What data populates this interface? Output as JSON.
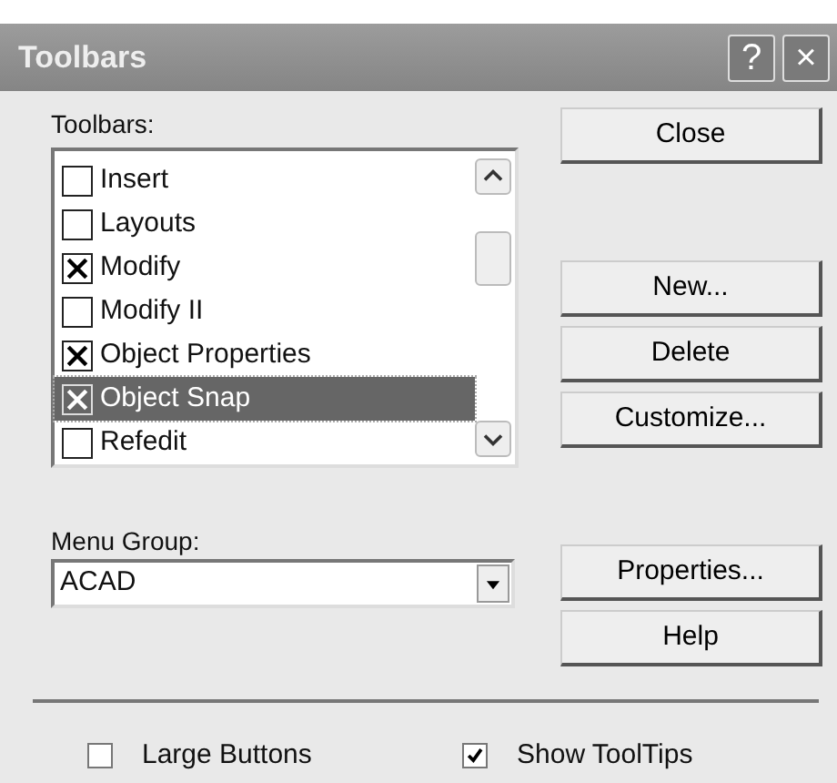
{
  "window": {
    "title": "Toolbars",
    "help_button": "?",
    "close_button": "×"
  },
  "toolbars_label": "Toolbars:",
  "toolbars": [
    {
      "label": "Insert",
      "checked": false,
      "selected": false
    },
    {
      "label": "Layouts",
      "checked": false,
      "selected": false
    },
    {
      "label": "Modify",
      "checked": true,
      "selected": false
    },
    {
      "label": "Modify II",
      "checked": false,
      "selected": false
    },
    {
      "label": "Object Properties",
      "checked": true,
      "selected": false
    },
    {
      "label": "Object Snap",
      "checked": true,
      "selected": true
    },
    {
      "label": "Refedit",
      "checked": false,
      "selected": false
    }
  ],
  "menu_group": {
    "label": "Menu Group:",
    "value": "ACAD"
  },
  "button_groups": [
    [
      "Close"
    ],
    [
      "New...",
      "Delete",
      "Customize..."
    ],
    [
      "Properties...",
      "Help"
    ]
  ],
  "options": [
    {
      "label": "Large Buttons",
      "checked": false
    },
    {
      "label": "Show ToolTips",
      "checked": true
    }
  ]
}
